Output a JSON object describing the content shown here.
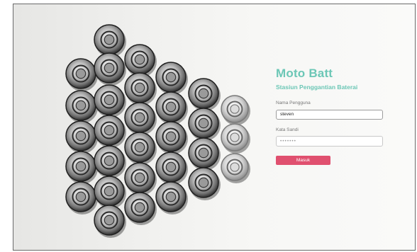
{
  "app": {
    "title": "Moto Batt",
    "subtitle": "Stasiun Penggantian Baterai"
  },
  "form": {
    "username_label": "Nama Pengguna",
    "username_value": "steven",
    "password_label": "Kata Sandi",
    "password_value": "•••••••",
    "submit_label": "Masuk"
  },
  "colors": {
    "accent": "#6cc7b6",
    "button": "#e0506f"
  },
  "icons": {
    "hero": "battery-stack-image"
  }
}
